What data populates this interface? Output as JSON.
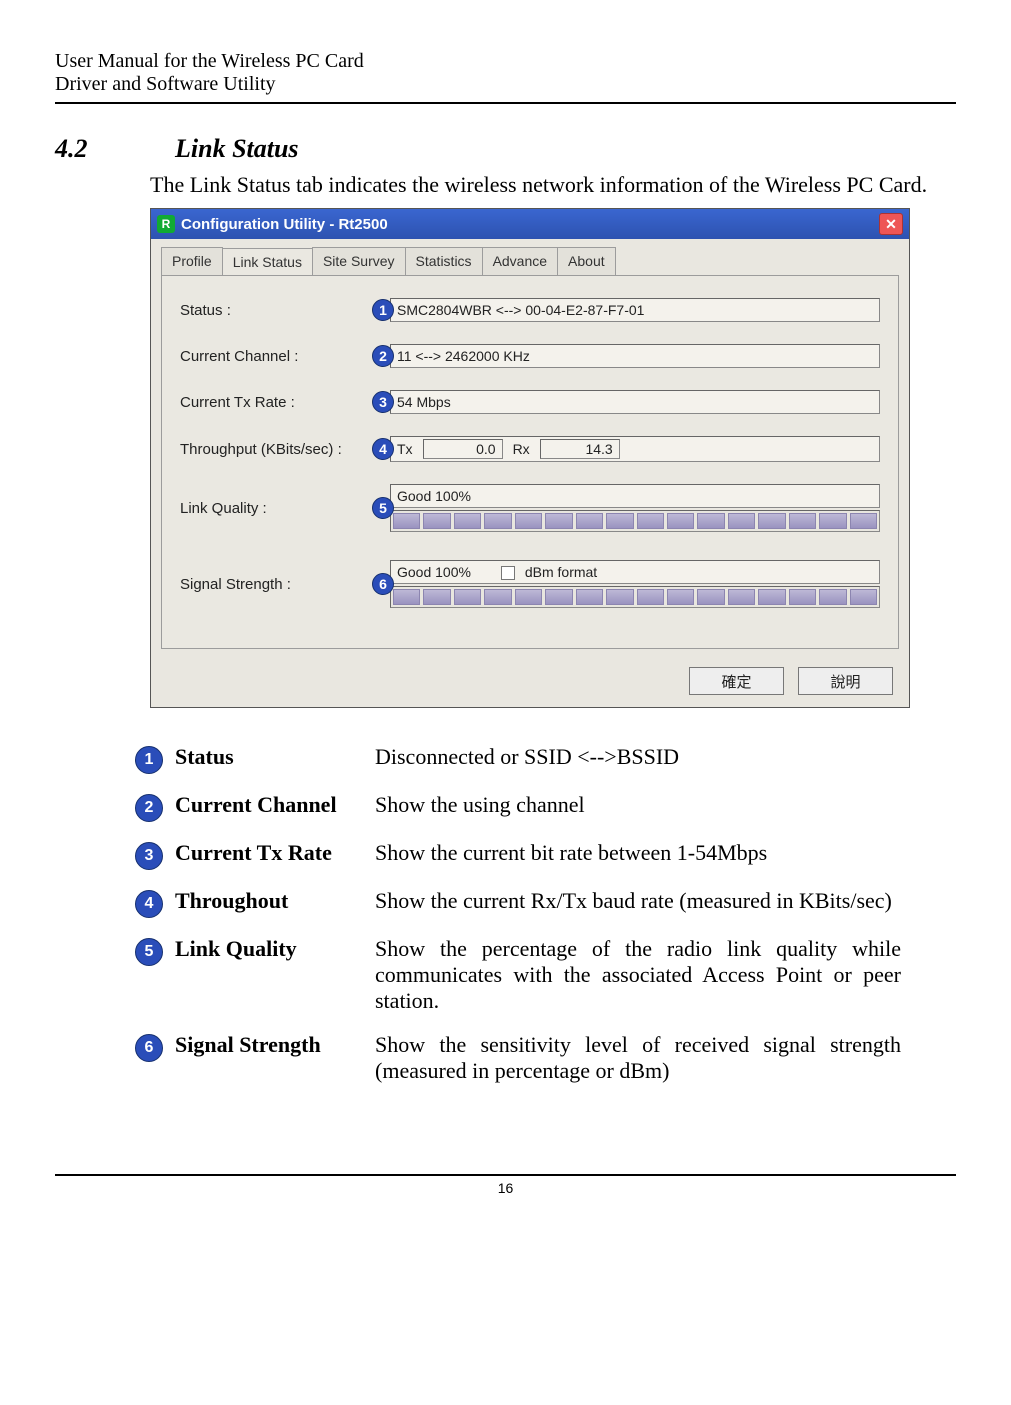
{
  "header": {
    "line1": "User Manual for the Wireless PC Card",
    "line2": "Driver and Software Utility"
  },
  "section": {
    "number": "4.2",
    "title": "Link Status",
    "intro": "The Link Status tab indicates the wireless network information of the Wireless PC Card."
  },
  "screenshot": {
    "window_title": "Configuration Utility - Rt2500",
    "logo_text": "R",
    "close_text": "✕",
    "tabs": [
      "Profile",
      "Link Status",
      "Site Survey",
      "Statistics",
      "Advance",
      "About"
    ],
    "active_tab_index": 1,
    "rows": {
      "status_label": "Status :",
      "status_value": "SMC2804WBR <--> 00-04-E2-87-F7-01",
      "channel_label": "Current Channel :",
      "channel_value": "11 <--> 2462000 KHz",
      "txrate_label": "Current Tx Rate :",
      "txrate_value": "54 Mbps",
      "throughput_label": "Throughput (KBits/sec) :",
      "tx_label": "Tx",
      "tx_value": "0.0",
      "rx_label": "Rx",
      "rx_value": "14.3",
      "linkq_label": "Link Quality :",
      "linkq_value": "Good 100%",
      "sigstr_label": "Signal Strength :",
      "sigstr_value": "Good 100%",
      "dbm_label": "dBm format"
    },
    "buttons": {
      "ok": "確定",
      "help": "說明"
    }
  },
  "definitions": [
    {
      "num": "1",
      "term": "Status",
      "desc": "Disconnected or SSID <-->BSSID"
    },
    {
      "num": "2",
      "term": "Current Channel",
      "desc": "Show the using channel"
    },
    {
      "num": "3",
      "term": "Current Tx Rate",
      "desc": "Show the current bit rate between 1-54Mbps"
    },
    {
      "num": "4",
      "term": "Throughout",
      "desc": "Show the current Rx/Tx baud rate (measured in KBits/sec)"
    },
    {
      "num": "5",
      "term": "Link Quality",
      "desc": "Show the percentage of the radio link quality while communicates with the associated Access Point or peer station."
    },
    {
      "num": "6",
      "term": "Signal Strength",
      "desc": "Show the sensitivity level of received signal strength (measured in percentage or dBm)"
    }
  ],
  "footer": {
    "page": "16"
  }
}
